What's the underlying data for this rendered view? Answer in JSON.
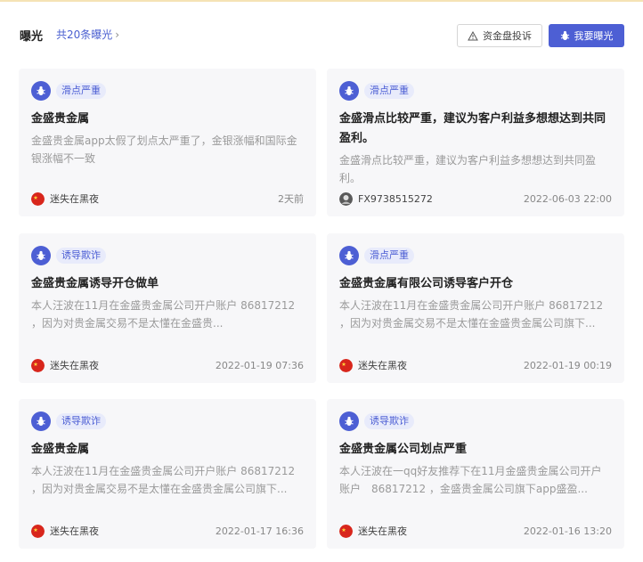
{
  "header": {
    "title": "曝光",
    "count_link": "共20条曝光",
    "complaint_button": "资金盘投诉",
    "expose_button": "我要曝光"
  },
  "cards": [
    {
      "tag": "滑点严重",
      "title": "金盛贵金属",
      "desc": "金盛贵金属app太假了划点太严重了，金银涨幅和国际金银涨幅不一致",
      "author": "迷失在黑夜",
      "avatar": "flag-icon",
      "time": "2天前"
    },
    {
      "tag": "滑点严重",
      "title": "金盛滑点比较严重，建议为客户利益多想想达到共同盈利。",
      "desc": "金盛滑点比较严重，建议为客户利益多想想达到共同盈利。",
      "author": "FX9738515272",
      "avatar": "user-avatar-icon",
      "time": "2022-06-03 22:00"
    },
    {
      "tag": "诱导欺诈",
      "title": "金盛贵金属诱导开仓做单",
      "desc": "本人汪波在11月在金盛贵金属公司开户账户 86817212 ，因为对贵金属交易不是太懂在金盛贵...",
      "author": "迷失在黑夜",
      "avatar": "flag-icon",
      "time": "2022-01-19 07:36"
    },
    {
      "tag": "滑点严重",
      "title": "金盛贵金属有限公司诱导客户开仓",
      "desc": "本人汪波在11月在金盛贵金属公司开户账户 86817212 ，因为对贵金属交易不是太懂在金盛贵金属公司旗下...",
      "author": "迷失在黑夜",
      "avatar": "flag-icon",
      "time": "2022-01-19 00:19"
    },
    {
      "tag": "诱导欺诈",
      "title": "金盛贵金属",
      "desc": "本人汪波在11月在金盛贵金属公司开户账户 86817212 ，因为对贵金属交易不是太懂在金盛贵金属公司旗下...",
      "author": "迷失在黑夜",
      "avatar": "flag-icon",
      "time": "2022-01-17 16:36"
    },
    {
      "tag": "诱导欺诈",
      "title": "金盛贵金属公司划点严重",
      "desc": "本人汪波在一qq好友推荐下在11月金盛贵金属公司开户账户　86817212 ，金盛贵金属公司旗下app盛盈...",
      "author": "迷失在黑夜",
      "avatar": "flag-icon",
      "time": "2022-01-16 13:20"
    }
  ],
  "colors": {
    "accent": "#4d5fd4",
    "tag_bg": "#e8ebfb",
    "card_bg": "#f7f7f9"
  }
}
